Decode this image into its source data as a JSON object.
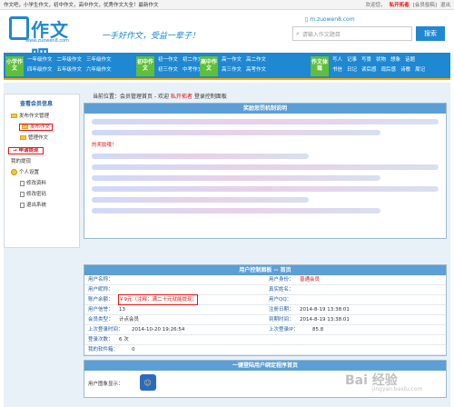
{
  "topbar": {
    "left": "作文吧，小学生作文，初中作文，高中作文，优秀作文大全！最新作文",
    "welcome": "欢迎您，",
    "user": "私开拓者",
    "links": "[会员投稿]",
    "exit": "退出"
  },
  "header": {
    "logo_text": "作文吧",
    "logo_url": "www.zuowen8.com",
    "slogan": "一手好作文，受益一辈子！",
    "mobile": "m.zuowen8.com",
    "search_placeholder": "请输入作文题目",
    "search_button": "搜索"
  },
  "nav": {
    "xiaoxue": {
      "tag": "小学作文",
      "links": [
        "一年级作文",
        "二年级作文",
        "三年级作文",
        "四年级作文",
        "五年级作文",
        "六年级作文"
      ]
    },
    "chuzhong": {
      "tag": "初中作文",
      "links": [
        "初一作文",
        "初二作文",
        "初三作文",
        "中考作文"
      ]
    },
    "gaozhong": {
      "tag": "高中作文",
      "links": [
        "高一作文",
        "高二作文",
        "高三作文",
        "高考作文"
      ]
    },
    "ticai": {
      "tag": "作文体裁",
      "links": [
        "写人",
        "记事",
        "写景",
        "状物",
        "想象",
        "话题",
        "书信",
        "日记",
        "读后感",
        "观后感",
        "诗歌",
        "周记"
      ]
    }
  },
  "sidebar": {
    "title": "查看会员信息",
    "items": [
      {
        "label": "发布作文管理",
        "type": "folder"
      },
      {
        "label": "发布作文",
        "type": "folder",
        "highlight": true
      },
      {
        "label": "管理作文",
        "type": "folder"
      },
      {
        "label": "申请提现",
        "type": "link",
        "highlight": true
      },
      {
        "label": "我的提现",
        "type": "text"
      },
      {
        "label": "个人设置",
        "type": "smile"
      },
      {
        "label": "修改资料",
        "type": "doc"
      },
      {
        "label": "修改密码",
        "type": "doc"
      },
      {
        "label": "退出系统",
        "type": "doc"
      }
    ]
  },
  "crumb": {
    "prefix": "当前位置：会员管理首页 - 欢迎",
    "user": "私开拓者",
    "suffix": "登录控制面板"
  },
  "panel1": {
    "title": "奖励惩罚机制说明",
    "red_note": "的奖励哦！"
  },
  "panel2": {
    "title": "用户控制面板 -- 首页",
    "rows": [
      [
        {
          "k": "用户名称：",
          "v": ""
        },
        {
          "k": "用户身份：",
          "v": "普通会员",
          "red": true
        }
      ],
      [
        {
          "k": "用户昵称：",
          "v": ""
        },
        {
          "k": "真实姓名：",
          "v": ""
        }
      ],
      [
        {
          "k": "账户余额：",
          "v": "￥9元（注释：满二十元就能提现）",
          "red": true,
          "balance": true
        },
        {
          "k": "用户QQ：",
          "v": ""
        }
      ],
      [
        {
          "k": "用户信誉：",
          "v": "13"
        },
        {
          "k": "注册日期：",
          "v": "2014-8-19 13:38:01"
        }
      ],
      [
        {
          "k": "会员类型：",
          "v": "计点会员"
        },
        {
          "k": "到期时间：",
          "v": "2014-8-19 13:38:01"
        }
      ],
      [
        {
          "k": "上次登录时间：",
          "v": "2014-10-20 19:26:54"
        },
        {
          "k": "上次登录IP：",
          "v": "85.8"
        }
      ],
      [
        {
          "k": "登录次数：",
          "v": "6 次"
        },
        {
          "k": "",
          "v": ""
        }
      ],
      [
        {
          "k": "我的软件箱：",
          "v": "0"
        },
        {
          "k": "",
          "v": ""
        }
      ]
    ]
  },
  "panel3": {
    "title": "一键登陆用户绑定程序首页",
    "label": "用户图象显示："
  },
  "watermark": {
    "main": "Bai 经验",
    "sub": "jingyan.baidu.com"
  },
  "colors": {
    "brand": "#1e88d2",
    "accent": "#f7a600",
    "alert": "#d11111"
  }
}
